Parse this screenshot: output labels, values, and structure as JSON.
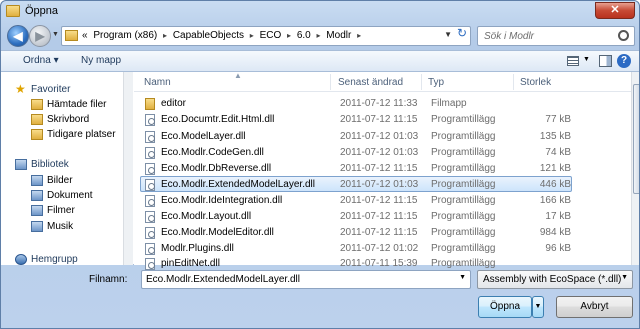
{
  "window": {
    "title": "Öppna",
    "close_glyph": "✕"
  },
  "nav_buttons": {
    "back_glyph": "◀",
    "forward_glyph": "▶",
    "history_glyph": "▼"
  },
  "address": {
    "prefix": "«",
    "crumbs": [
      "Program (x86)",
      "CapableObjects",
      "ECO",
      "6.0",
      "Modlr"
    ],
    "separator": "▸",
    "dropdown_glyph": "▼",
    "refresh_glyph": "↻"
  },
  "search": {
    "placeholder": "Sök i Modlr"
  },
  "toolbar": {
    "organize": "Ordna ▾",
    "new_folder": "Ny mapp",
    "help": "?",
    "views_drop": "▼"
  },
  "sidebar": {
    "items": [
      {
        "label": "Favoriter",
        "icon": "star-icon",
        "level": 1
      },
      {
        "label": "Hämtade filer",
        "icon": "folder-icon",
        "level": 2
      },
      {
        "label": "Skrivbord",
        "icon": "folder-icon",
        "level": 2
      },
      {
        "label": "Tidigare platser",
        "icon": "folder-icon",
        "level": 2
      },
      {
        "label": "Bibliotek",
        "icon": "library-icon",
        "level": 1
      },
      {
        "label": "Bilder",
        "icon": "library-icon",
        "level": 2
      },
      {
        "label": "Dokument",
        "icon": "library-icon",
        "level": 2
      },
      {
        "label": "Filmer",
        "icon": "library-icon",
        "level": 2
      },
      {
        "label": "Musik",
        "icon": "library-icon",
        "level": 2
      },
      {
        "label": "Hemgrupp",
        "icon": "network-icon",
        "level": 1
      }
    ]
  },
  "columns": {
    "name": "Namn",
    "modified": "Senast ändrad",
    "type": "Typ",
    "size": "Storlek"
  },
  "files": [
    {
      "name": "editor",
      "modified": "2011-07-12 11:33",
      "type": "Filmapp",
      "size": "",
      "kind": "folder"
    },
    {
      "name": "Eco.Documtr.Edit.Html.dll",
      "modified": "2011-07-12 11:15",
      "type": "Programtillägg",
      "size": "77 kB",
      "kind": "dll"
    },
    {
      "name": "Eco.ModelLayer.dll",
      "modified": "2011-07-12 01:03",
      "type": "Programtillägg",
      "size": "135 kB",
      "kind": "dll"
    },
    {
      "name": "Eco.Modlr.CodeGen.dll",
      "modified": "2011-07-12 01:03",
      "type": "Programtillägg",
      "size": "74 kB",
      "kind": "dll"
    },
    {
      "name": "Eco.Modlr.DbReverse.dll",
      "modified": "2011-07-12 11:15",
      "type": "Programtillägg",
      "size": "121 kB",
      "kind": "dll"
    },
    {
      "name": "Eco.Modlr.ExtendedModelLayer.dll",
      "modified": "2011-07-12 01:03",
      "type": "Programtillägg",
      "size": "446 kB",
      "kind": "dll",
      "selected": true
    },
    {
      "name": "Eco.Modlr.IdeIntegration.dll",
      "modified": "2011-07-12 11:15",
      "type": "Programtillägg",
      "size": "166 kB",
      "kind": "dll"
    },
    {
      "name": "Eco.Modlr.Layout.dll",
      "modified": "2011-07-12 11:15",
      "type": "Programtillägg",
      "size": "17 kB",
      "kind": "dll"
    },
    {
      "name": "Eco.Modlr.ModelEditor.dll",
      "modified": "2011-07-12 11:15",
      "type": "Programtillägg",
      "size": "984 kB",
      "kind": "dll"
    },
    {
      "name": "Modlr.Plugins.dll",
      "modified": "2011-07-12 01:02",
      "type": "Programtillägg",
      "size": "96 kB",
      "kind": "dll"
    },
    {
      "name": "pinEditNet.dll",
      "modified": "2011-07-11 15:39",
      "type": "Programtillägg",
      "size": "",
      "kind": "dll"
    }
  ],
  "footer": {
    "filename_label": "Filnamn:",
    "filename_value": "Eco.Modlr.ExtendedModelLayer.dll",
    "filter_value": "Assembly with EcoSpace (*.dll)",
    "open_label": "Öppna",
    "open_split_glyph": "▼",
    "cancel_label": "Avbryt"
  }
}
